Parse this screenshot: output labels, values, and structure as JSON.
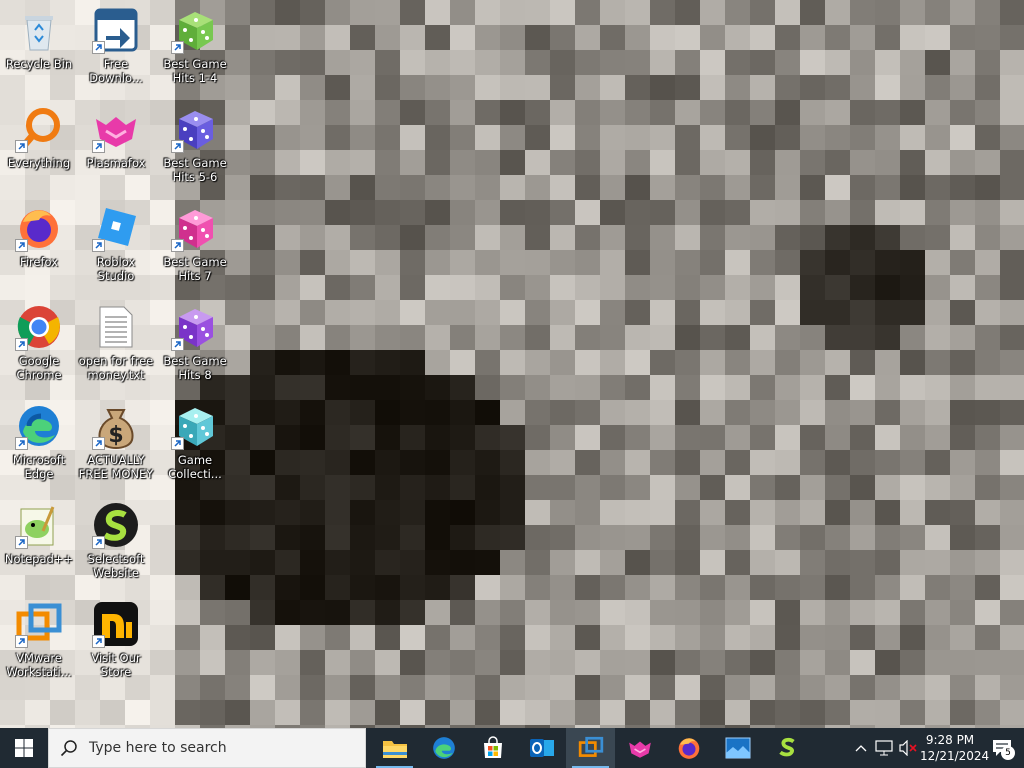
{
  "desktop": {
    "icons": [
      {
        "label": "Recycle Bin",
        "icon": "recycle-bin-icon",
        "shortcut": false
      },
      {
        "label": "Everything",
        "icon": "everything-search-icon",
        "shortcut": true
      },
      {
        "label": "Firefox",
        "icon": "firefox-icon",
        "shortcut": true
      },
      {
        "label": "Google Chrome",
        "icon": "chrome-icon",
        "shortcut": true
      },
      {
        "label": "Microsoft Edge",
        "icon": "edge-icon",
        "shortcut": true
      },
      {
        "label": "Notepad++",
        "icon": "notepad-plus-plus-icon",
        "shortcut": true
      },
      {
        "label": "VMware Workstati...",
        "icon": "vmware-workstation-icon",
        "shortcut": true
      },
      {
        "label": "Free Downlo...",
        "icon": "free-download-manager-icon",
        "shortcut": true
      },
      {
        "label": "Plasmafox",
        "icon": "plasmafox-icon",
        "shortcut": true
      },
      {
        "label": "Roblox Studio",
        "icon": "roblox-studio-icon",
        "shortcut": true
      },
      {
        "label": "open for free money.txt",
        "icon": "text-file-icon",
        "shortcut": false
      },
      {
        "label": "ACTUALLY FREE MONEY",
        "icon": "money-bag-icon",
        "shortcut": true
      },
      {
        "label": "Selectsoft Website",
        "icon": "selectsoft-icon",
        "shortcut": true
      },
      {
        "label": "Visit Our Store",
        "icon": "store-icon",
        "shortcut": true
      },
      {
        "label": "Best Game Hits 1-4",
        "icon": "dice-green-icon",
        "shortcut": true
      },
      {
        "label": "Best Game Hits 5-6",
        "icon": "dice-blue-icon",
        "shortcut": true
      },
      {
        "label": "Best Game Hits 7",
        "icon": "dice-pink-icon",
        "shortcut": true
      },
      {
        "label": "Best Game Hits 8",
        "icon": "dice-purple-icon",
        "shortcut": true
      },
      {
        "label": "Game Collecti...",
        "icon": "dice-cyan-icon",
        "shortcut": true
      }
    ]
  },
  "taskbar": {
    "search_placeholder": "Type here to search",
    "pinned": [
      {
        "name": "file-explorer-icon"
      },
      {
        "name": "edge-icon"
      },
      {
        "name": "microsoft-store-icon"
      },
      {
        "name": "outlook-icon"
      },
      {
        "name": "vmware-icon"
      },
      {
        "name": "plasmafox-icon"
      },
      {
        "name": "firefox-icon"
      },
      {
        "name": "photos-icon"
      },
      {
        "name": "selectsoft-icon"
      }
    ],
    "clock": {
      "time": "9:28 PM",
      "date": "12/21/2024"
    },
    "notification_count": "5"
  },
  "colors": {
    "taskbar_bg": "#202a33",
    "accent": "#76b9ed",
    "search_bg": "#f3f3f3"
  }
}
